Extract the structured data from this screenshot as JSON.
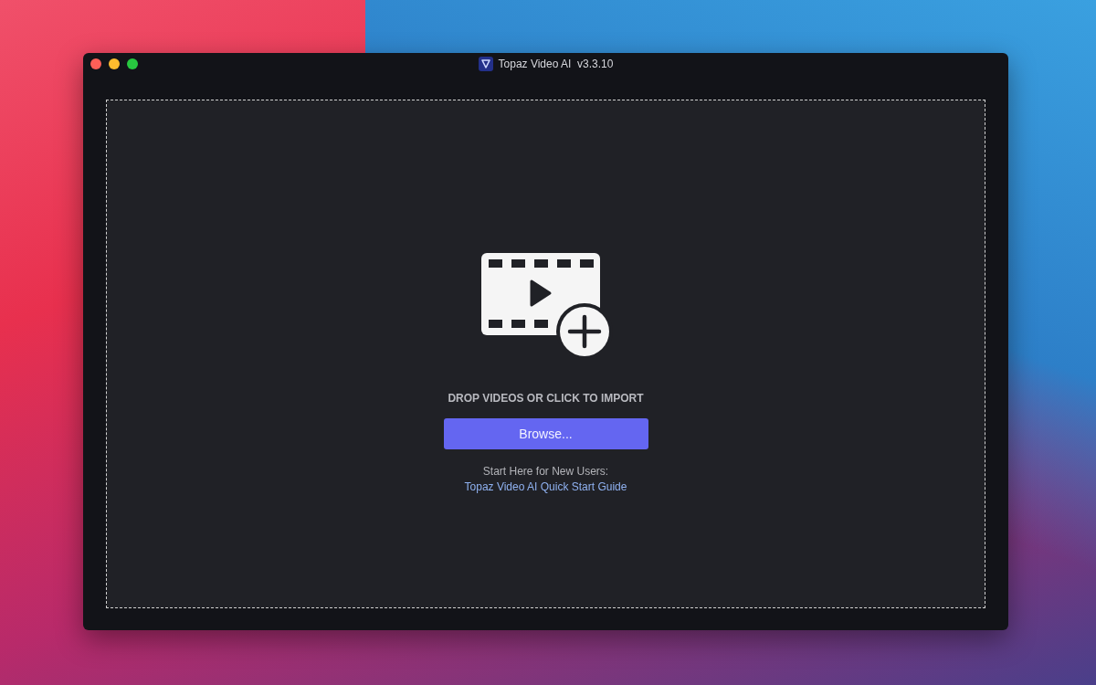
{
  "window": {
    "title": "Topaz Video AI  v3.3.10"
  },
  "drop_zone": {
    "heading": "DROP VIDEOS OR CLICK TO IMPORT",
    "browse_button": "Browse...",
    "hint": "Start Here for New Users:",
    "guide_link": "Topaz Video AI Quick Start Guide"
  }
}
